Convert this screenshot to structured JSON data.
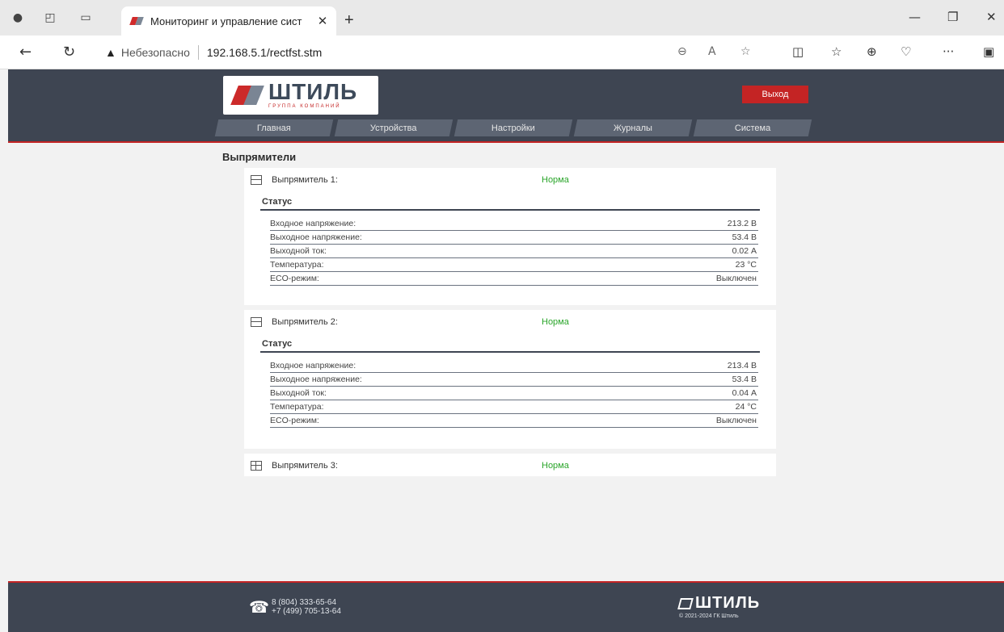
{
  "browser": {
    "tab_title": "Мониторинг и управление сист",
    "tab_close": "✕",
    "new_tab": "+",
    "insecure_label": "Небезопасно",
    "url": "192.168.5.1/rectfst.stm",
    "more": "···"
  },
  "header": {
    "logo_text": "ШТИЛЬ",
    "logo_subtext": "ГРУППА КОМПАНИЙ",
    "logout_label": "Выход",
    "menu": [
      "Главная",
      "Устройства",
      "Настройки",
      "Журналы",
      "Система"
    ]
  },
  "main": {
    "section_title": "Выпрямители",
    "rectifiers": [
      {
        "name": "Выпрямитель 1:",
        "state": "Норма",
        "status_title": "Статус",
        "rows": [
          {
            "label": "Входное напряжение:",
            "value": "213.2 В"
          },
          {
            "label": "Выходное напряжение:",
            "value": "53.4 В"
          },
          {
            "label": "Выходной ток:",
            "value": "0.02 А"
          },
          {
            "label": "Температура:",
            "value": "23 °С"
          },
          {
            "label": "ECO-режим:",
            "value": "Выключен"
          }
        ]
      },
      {
        "name": "Выпрямитель 2:",
        "state": "Норма",
        "status_title": "Статус",
        "rows": [
          {
            "label": "Входное напряжение:",
            "value": "213.4 В"
          },
          {
            "label": "Выходное напряжение:",
            "value": "53.4 В"
          },
          {
            "label": "Выходной ток:",
            "value": "0.04 А"
          },
          {
            "label": "Температура:",
            "value": "24 °С"
          },
          {
            "label": "ECO-режим:",
            "value": "Выключен"
          }
        ]
      },
      {
        "name": "Выпрямитель 3:",
        "state": "Норма"
      }
    ]
  },
  "footer": {
    "phone1": "8 (804) 333-65-64",
    "phone2": "+7 (499) 705-13-64",
    "logo_text": "ШТИЛЬ",
    "copyright": "© 2021-2024 ГК Штиль"
  },
  "colors": {
    "header_bg": "#3e4552",
    "accent_red": "#c42424",
    "status_green": "#2aa52a"
  }
}
